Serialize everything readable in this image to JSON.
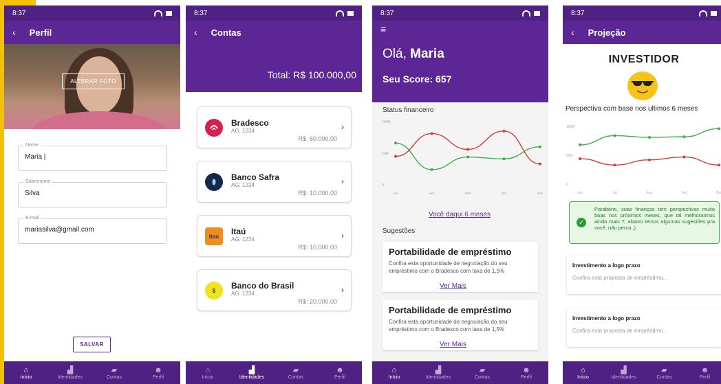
{
  "status": {
    "time": "8:37"
  },
  "colors": {
    "primary": "#5c2694",
    "nav": "#4f2183",
    "accent_yellow": "#f2c20b",
    "line_green": "#3fad46",
    "line_red": "#d93a3a"
  },
  "nav": {
    "items": [
      {
        "label": "Início",
        "icon": "home-icon"
      },
      {
        "label": "Identidades",
        "icon": "building-icon"
      },
      {
        "label": "Contas",
        "icon": "book-icon"
      },
      {
        "label": "Perfil",
        "icon": "user-icon"
      }
    ]
  },
  "perfil": {
    "title": "Perfil",
    "change_photo": "ALTERAR FOTO",
    "fields": [
      {
        "label": "Nome",
        "value": "Maria |"
      },
      {
        "label": "Sobrenome",
        "value": "Silva"
      },
      {
        "label": "E-mail",
        "value": "mariasilva@gmail.com"
      }
    ],
    "save": "SALVAR"
  },
  "contas": {
    "title": "Contas",
    "total": "Total: R$ 100.000,00",
    "banks": [
      {
        "name": "Bradesco",
        "agency": "AG: 1234",
        "value": "R$: 60.000,00",
        "logo_color": "#d6204d",
        "logo_text": ""
      },
      {
        "name": "Banco Safra",
        "agency": "AG: 1234",
        "value": "R$: 10.000,00",
        "logo_color": "#13294b",
        "logo_text": ""
      },
      {
        "name": "Itaú",
        "agency": "AG: 1234",
        "value": "R$: 10.000,00",
        "logo_color": "#f28c1a",
        "logo_text": "Itaú"
      },
      {
        "name": "Banco do Brasil",
        "agency": "AG: 1234",
        "value": "R$: 20.000,00",
        "logo_color": "#f2e21b",
        "logo_text": "$"
      }
    ]
  },
  "inicio": {
    "greeting": "Olá,",
    "name": "Maria",
    "score": "Seu Score: 657",
    "status_title": "Status financeiro",
    "future_link": "Você daqui 6 meses",
    "suggestions_title": "Sugestões",
    "suggestions": [
      {
        "title": "Portabilidade de empréstimo",
        "text": "Confira esta oportunidade de negociação do seu empréstimo com o Bradesco com taxa de 1,5%",
        "link": "Ver Mais"
      },
      {
        "title": "Portabilidade de empréstimo",
        "text": "Confira esta oportunidade de negociação do seu empréstimo com o Bradesco com taxa de 1,5%",
        "link": "Ver Mais"
      }
    ]
  },
  "projecao": {
    "title": "Projeção",
    "profile": "INVESTIDOR",
    "perspective": "Perspectiva com base nos ultimos 6 meses",
    "alert": "Parabéns, suas finanças tem perspectivas muito boas nos próximos meses, que tal melhorarmos ainda mais ?, abaixo temos algumas sugestões pra você, não perca ;)",
    "cards": [
      {
        "title": "Investimento a logo prazo",
        "text": "Confira esta proposta de empréstimo..."
      },
      {
        "title": "Investimento a logo prazo",
        "text": "Confira esta proposta de empréstimo..."
      }
    ]
  },
  "chart_data": [
    {
      "type": "line",
      "categories": [
        "Jan",
        "Fev",
        "Mar",
        "Abr",
        "Mai"
      ],
      "y_ticks": [
        "0",
        "50M",
        "100M"
      ],
      "ylim": [
        0,
        100
      ],
      "series": [
        {
          "color": "#3fad46",
          "values": [
            66,
            24,
            44,
            41,
            60
          ]
        },
        {
          "color": "#d93a3a",
          "values": [
            45,
            81,
            56,
            85,
            33
          ]
        }
      ]
    },
    {
      "type": "line",
      "categories": [
        "Jun",
        "Jul",
        "Ago",
        "Set",
        "Out"
      ],
      "y_ticks": [
        "0",
        "50M",
        "100M"
      ],
      "ylim": [
        0,
        100
      ],
      "series": [
        {
          "color": "#3fad46",
          "values": [
            68,
            84,
            81,
            82,
            96
          ]
        },
        {
          "color": "#d93a3a",
          "values": [
            44,
            33,
            42,
            47,
            33
          ]
        }
      ]
    }
  ]
}
